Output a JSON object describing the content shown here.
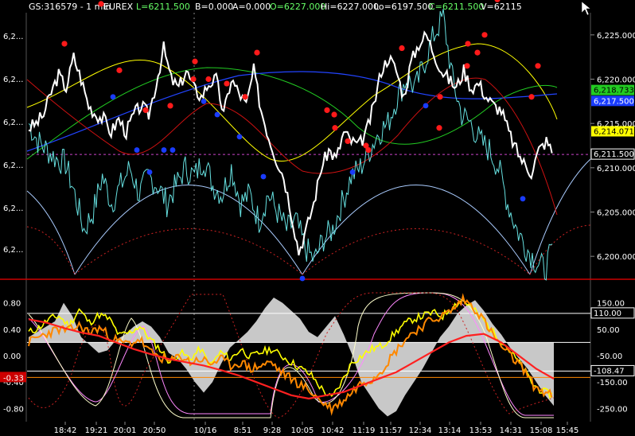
{
  "header": {
    "symbol": "GS:316579 - 1 min",
    "exchange": "EUREX",
    "last": "L=6211.500",
    "bid": "B=0.000",
    "ask": "A=0.000",
    "open": "O=6227.000",
    "high": "Hi=6227.000",
    "low": "Lo=6197.500",
    "close": "C=6211.500",
    "volume": "V=62115"
  },
  "colors": {
    "background": "#000000",
    "price": "#ffffff",
    "cyan": "#66e0e0",
    "red_dot": "#ff1a1a",
    "blue_dot": "#1a3cff",
    "yellow": "#ffff00",
    "green": "#22cc22",
    "orange": "#ff8800",
    "divider": "#cc0000",
    "grey_hist": "#c8c8c8",
    "magenta": "#ff44ff"
  },
  "chart_data": [
    {
      "type": "line",
      "panel": "price",
      "left_axis_ticks": [
        "6,2...",
        "6,2...",
        "6,2...",
        "6,2...",
        "6,2..."
      ],
      "right_axis_ticks": [
        6225,
        6220,
        6215,
        6210,
        6205,
        6200
      ],
      "right_axis_tick_labels": [
        "6,225.000",
        "6,220.000",
        "6,215.000",
        "6,210.000",
        "6,205.000",
        "6,200.000"
      ],
      "ylim": [
        6197.5,
        6227.5
      ],
      "markers": [
        {
          "label": "6,218.733",
          "value": 6218.733,
          "color": "#22cc22"
        },
        {
          "label": "6,217.500",
          "value": 6217.5,
          "color": "#1a3cff"
        },
        {
          "label": "6,214.071",
          "value": 6214.071,
          "color": "#ffff00"
        },
        {
          "label": "6,211.500",
          "value": 6211.5,
          "color": "#000000"
        }
      ],
      "current_price_line": 6211.5,
      "price_series": [
        6214.5,
        6215.0,
        6216.0,
        6218.5,
        6220.5,
        6219.0,
        6222.5,
        6220.0,
        6217.0,
        6216.0,
        6215.5,
        6214.0,
        6215.5,
        6214.0,
        6216.0,
        6217.0,
        6216.0,
        6219.5,
        6223.5,
        6220.0,
        6219.0,
        6221.0,
        6219.0,
        6218.0,
        6219.5,
        6220.0,
        6216.0,
        6220.0,
        6218.5,
        6217.0,
        6221.0,
        6216.5,
        6213.5,
        6211.0,
        6209.0,
        6205.0,
        6200.5,
        6203.0,
        6206.0,
        6210.0,
        6212.0,
        6211.0,
        6214.0,
        6213.0,
        6212.5,
        6214.0,
        6217.0,
        6221.0,
        6222.5,
        6221.0,
        6218.0,
        6222.0,
        6224.0,
        6225.0,
        6223.0,
        6221.0,
        6220.0,
        6219.0,
        6221.0,
        6219.0,
        6219.5,
        6218.0,
        6217.0,
        6216.5,
        6214.0,
        6212.0,
        6210.5,
        6209.5,
        6212.0,
        6213.0,
        6211.5
      ],
      "cyan_series": [
        6215.0,
        6213.0,
        6212.0,
        6211.0,
        6210.5,
        6207.0,
        6203.0,
        6205.0,
        6209.0,
        6206.0,
        6208.0,
        6210.0,
        6207.0,
        6209.0,
        6208.0,
        6206.0,
        6208.0,
        6210.0,
        6209.0,
        6211.0,
        6208.0,
        6207.0,
        6210.0,
        6206.0,
        6207.0,
        6204.0,
        6207.0,
        6205.0,
        6203.0,
        6204.0,
        6201.0,
        6199.5,
        6202.0,
        6203.0,
        6206.0,
        6209.0,
        6210.0,
        6212.0,
        6214.0,
        6215.0,
        6218.0,
        6220.0,
        6219.0,
        6222.0,
        6225.0,
        6227.0,
        6220.0,
        6216.0,
        6215.0,
        6213.0,
        6212.0,
        6210.0,
        6206.0,
        6203.0,
        6201.0,
        6199.5,
        6198.5,
        6201.0
      ],
      "red_dots": [
        6228.5,
        6224.0,
        6221.0,
        6220.0,
        6216.5,
        6217.0,
        6220.0,
        6219.5,
        6218.0,
        6223.0,
        6222.0,
        6223.5,
        6216.5,
        6214.5,
        6213.0,
        6212.0,
        6218.0,
        6221.5,
        6229.0,
        6225.0,
        6224.0,
        6223.0,
        6221.5,
        6218.0,
        6216.0,
        6212.5,
        6214.5
      ],
      "blue_dots": [
        6218.0,
        6212.0,
        6209.5,
        6212.0,
        6212.0,
        6217.5,
        6216.0,
        6213.5,
        6209.0,
        6209.5,
        6217.0,
        6206.5,
        6197.5
      ],
      "x_ticks": [
        "18:42",
        "19:21",
        "20:01",
        "20:50",
        "10/16",
        "8:51",
        "9:28",
        "10:05",
        "10:42",
        "11:19",
        "11:57",
        "12:34",
        "13:14",
        "13:53",
        "14:31",
        "15:08",
        "15:45"
      ]
    },
    {
      "type": "line",
      "panel": "oscillator",
      "left_axis_ticks": [
        "0.80",
        "0.40",
        "0.00",
        "-0.40",
        "-0.80"
      ],
      "right_axis_ticks": [
        "150.00",
        "50.00",
        "-50.00",
        "-150.00",
        "-250.00"
      ],
      "left_marker": "-0.33",
      "right_markers": [
        {
          "label": "110.00",
          "value": 110
        },
        {
          "label": "-108.47",
          "value": -108.47
        }
      ],
      "ylim_left": [
        -1.0,
        1.0
      ],
      "ylim_right": [
        -300,
        200
      ],
      "yellow_series": [
        0.35,
        0.42,
        0.55,
        0.6,
        0.45,
        0.7,
        0.5,
        0.62,
        0.55,
        0.3,
        0.35,
        0.45,
        0.25,
        0.1,
        -0.1,
        0.05,
        -0.05,
        0.1,
        -0.15,
        0.05,
        -0.05,
        0.1,
        -0.02,
        0.05,
        0.1,
        0.0,
        -0.1,
        -0.2,
        -0.3,
        -0.5,
        -0.65,
        -0.4,
        -0.1,
        0.0,
        0.1,
        0.15,
        0.3,
        0.45,
        0.55,
        0.6,
        0.65,
        0.6,
        0.75,
        0.85,
        0.7,
        0.55,
        0.35,
        0.2,
        0.0,
        -0.2,
        -0.45,
        -0.55,
        -0.6
      ],
      "orange_series": [
        0.2,
        0.28,
        0.35,
        0.4,
        0.38,
        0.45,
        0.35,
        0.42,
        0.3,
        0.2,
        0.18,
        0.25,
        0.05,
        -0.02,
        -0.1,
        0.0,
        -0.1,
        -0.05,
        -0.12,
        -0.05,
        -0.15,
        -0.1,
        -0.2,
        -0.15,
        -0.1,
        -0.25,
        -0.35,
        -0.45,
        -0.55,
        -0.7,
        -0.8,
        -0.7,
        -0.55,
        -0.4,
        -0.35,
        -0.2,
        0.0,
        0.2,
        0.35,
        0.45,
        0.55,
        0.6,
        0.7,
        0.85,
        0.75,
        0.55,
        0.3,
        0.1,
        -0.05,
        -0.2,
        -0.45,
        -0.55,
        -0.62
      ],
      "red_thick_series": [
        0.55,
        0.5,
        0.42,
        0.35,
        0.3,
        0.2,
        0.1,
        0.02,
        -0.05,
        -0.1,
        -0.15,
        -0.22,
        -0.3,
        -0.4,
        -0.5,
        -0.6,
        -0.65,
        -0.6,
        -0.55,
        -0.45,
        -0.35,
        -0.25,
        -0.1,
        0.05,
        0.2,
        0.3,
        0.33,
        0.2,
        0.0,
        -0.2,
        -0.35
      ],
      "grey_histogram": [
        20,
        40,
        60,
        80,
        150,
        100,
        20,
        -10,
        -40,
        -30,
        10,
        30,
        60,
        80,
        60,
        20,
        -40,
        -60,
        -100,
        -150,
        -190,
        -150,
        -80,
        -20,
        10,
        40,
        80,
        130,
        170,
        150,
        120,
        90,
        40,
        20,
        60,
        100,
        30,
        -50,
        -150,
        -200,
        -250,
        -280,
        -260,
        -200,
        -150,
        -100,
        -40,
        20,
        60,
        110,
        140,
        160,
        120,
        70,
        30,
        -20,
        -60,
        -100,
        -150,
        -200,
        -240
      ],
      "white_hlines": [
        110,
        0,
        -108.47
      ],
      "orange_hline": -0.33
    }
  ]
}
